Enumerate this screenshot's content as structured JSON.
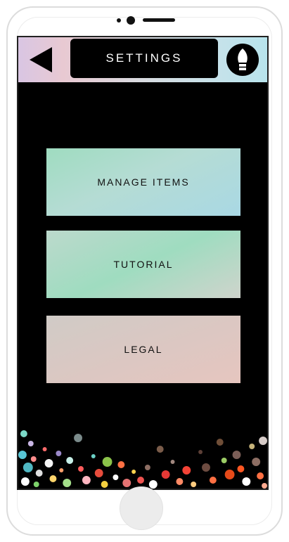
{
  "header": {
    "title": "SETTINGS",
    "back_icon": "back-arrow-icon",
    "bulb_icon": "lightbulb-icon"
  },
  "menu": {
    "items": [
      {
        "label": "MANAGE ITEMS"
      },
      {
        "label": "TUTORIAL"
      },
      {
        "label": "LEGAL"
      }
    ]
  },
  "colors": {
    "screen_background": "#000000",
    "header_gradient_start": "#d9c6e3",
    "header_gradient_end": "#b8e4ec",
    "manage_items_button": "#a9d8e4",
    "tutorial_button": "#9fdcc0",
    "legal_button": "#e6c6bf"
  }
}
